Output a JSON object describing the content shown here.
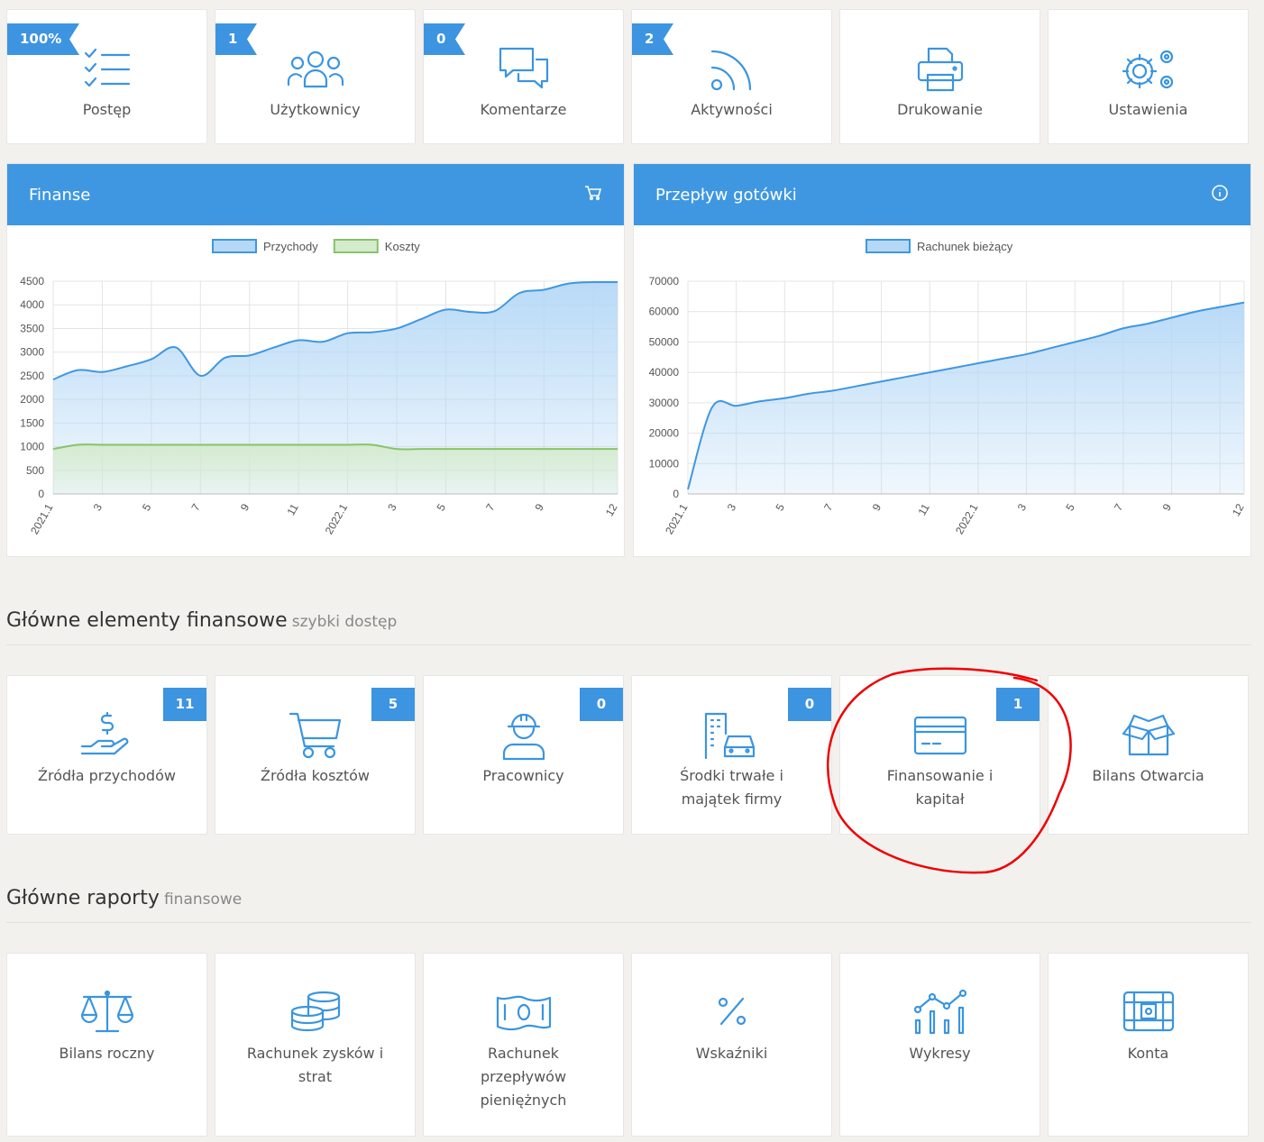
{
  "top_tiles": [
    {
      "label": "Postęp",
      "badge": "100%",
      "icon": "checklist-icon"
    },
    {
      "label": "Użytkownicy",
      "badge": "1",
      "icon": "users-icon"
    },
    {
      "label": "Komentarze",
      "badge": "0",
      "icon": "comments-icon"
    },
    {
      "label": "Aktywności",
      "badge": "2",
      "icon": "rss-icon"
    },
    {
      "label": "Drukowanie",
      "icon": "printer-icon"
    },
    {
      "label": "Ustawienia",
      "icon": "gears-icon"
    }
  ],
  "panels": {
    "finance": {
      "title": "Finanse",
      "icon": "cart-icon"
    },
    "cashflow": {
      "title": "Przepływ gotówki",
      "icon": "info-icon"
    }
  },
  "chart_data": [
    {
      "type": "area",
      "x": [
        "2021.1",
        "2",
        "3",
        "4",
        "5",
        "6",
        "7",
        "8",
        "9",
        "10",
        "11",
        "12",
        "2022.1",
        "2",
        "3",
        "4",
        "5",
        "6",
        "7",
        "8",
        "9",
        "10",
        "11",
        "12"
      ],
      "x_tick_labels": [
        "2021.1",
        "3",
        "5",
        "7",
        "9",
        "11",
        "2022.1",
        "3",
        "5",
        "7",
        "9",
        "12"
      ],
      "series": [
        {
          "name": "Przychody",
          "color": "#3f97e2",
          "fill": "#b5d8f6",
          "values": [
            2420,
            2620,
            2580,
            2700,
            2850,
            3100,
            2500,
            2880,
            2930,
            3100,
            3250,
            3220,
            3400,
            3420,
            3500,
            3700,
            3900,
            3850,
            3870,
            4250,
            4320,
            4450,
            4480,
            4480
          ]
        },
        {
          "name": "Koszty",
          "color": "#86c46a",
          "fill": "#d4ebcc",
          "values": [
            950,
            1040,
            1040,
            1040,
            1040,
            1040,
            1040,
            1040,
            1040,
            1040,
            1040,
            1040,
            1040,
            1040,
            950,
            950,
            950,
            950,
            950,
            950,
            950,
            950,
            950,
            950
          ]
        }
      ],
      "y_ticks": [
        0,
        500,
        1000,
        1500,
        2000,
        2500,
        3000,
        3500,
        4000,
        4500
      ],
      "ylim": [
        0,
        4500
      ],
      "legend": "top",
      "grid": true
    },
    {
      "type": "area",
      "x": [
        "2021.1",
        "2",
        "3",
        "4",
        "5",
        "6",
        "7",
        "8",
        "9",
        "10",
        "11",
        "12",
        "2022.1",
        "2",
        "3",
        "4",
        "5",
        "6",
        "7",
        "8",
        "9",
        "10",
        "11",
        "12"
      ],
      "x_tick_labels": [
        "2021.1",
        "3",
        "5",
        "7",
        "9",
        "11",
        "2022.1",
        "3",
        "5",
        "7",
        "9",
        "12"
      ],
      "series": [
        {
          "name": "Rachunek bieżący",
          "color": "#3f97e2",
          "fill": "#b5d8f6",
          "values": [
            1500,
            28500,
            29000,
            30500,
            31500,
            33000,
            34000,
            35500,
            37000,
            38500,
            40000,
            41500,
            43000,
            44500,
            46000,
            48000,
            50000,
            52000,
            54500,
            56000,
            58000,
            60000,
            61500,
            63000
          ]
        }
      ],
      "y_ticks": [
        0,
        10000,
        20000,
        30000,
        40000,
        50000,
        60000,
        70000
      ],
      "ylim": [
        0,
        70000
      ],
      "legend": "top",
      "grid": true
    }
  ],
  "section_quick": {
    "title": "Główne elementy finansowe",
    "subtitle": "szybki dostęp"
  },
  "quick_tiles": [
    {
      "label": "Źródła przychodów",
      "badge": "11",
      "icon": "dollar-hand-icon"
    },
    {
      "label": "Źródła kosztów",
      "badge": "5",
      "icon": "shopping-cart-icon"
    },
    {
      "label": "Pracownicy",
      "badge": "0",
      "icon": "worker-icon"
    },
    {
      "label": "Środki trwałe i majątek firmy",
      "badge": "0",
      "icon": "building-car-icon"
    },
    {
      "label": "Finansowanie i kapitał",
      "badge": "1",
      "icon": "credit-card-icon"
    },
    {
      "label": "Bilans Otwarcia",
      "icon": "open-box-icon"
    }
  ],
  "section_reports": {
    "title": "Główne raporty",
    "subtitle": "finansowe"
  },
  "report_tiles": [
    {
      "label": "Bilans roczny",
      "icon": "scales-icon"
    },
    {
      "label": "Rachunek zysków i strat",
      "icon": "coins-icon"
    },
    {
      "label": "Rachunek przepływów pieniężnych",
      "icon": "banknote-icon"
    },
    {
      "label": "Wskaźniki",
      "icon": "percent-icon"
    },
    {
      "label": "Wykresy",
      "icon": "chart-icon"
    },
    {
      "label": "Konta",
      "icon": "safe-icon"
    }
  ]
}
